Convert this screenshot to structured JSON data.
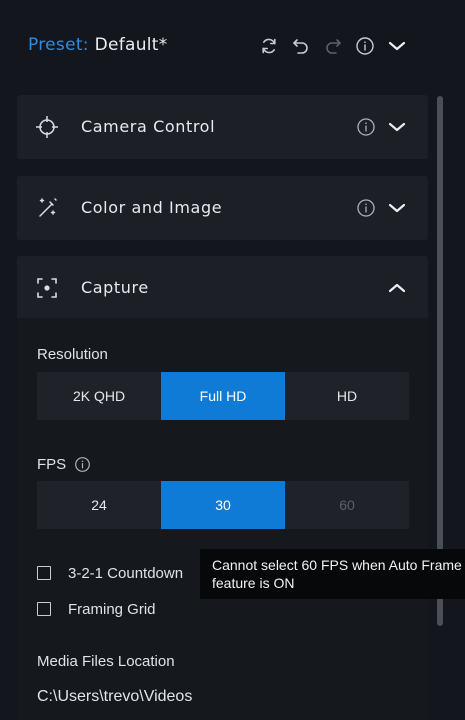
{
  "header": {
    "preset_label": "Preset:",
    "preset_value": "Default*",
    "icons": [
      "sync-icon",
      "undo-icon",
      "redo-icon",
      "info-icon",
      "chevron-down-icon"
    ]
  },
  "panels": [
    {
      "title": "Camera Control",
      "icon": "crosshair-icon",
      "expanded": false
    },
    {
      "title": "Color and Image",
      "icon": "magic-wand-icon",
      "expanded": false
    },
    {
      "title": "Capture",
      "icon": "capture-frame-icon",
      "expanded": true
    }
  ],
  "capture": {
    "resolution_label": "Resolution",
    "resolution_options": [
      "2K QHD",
      "Full HD",
      "HD"
    ],
    "resolution_selected": "Full HD",
    "fps_label": "FPS",
    "fps_options": [
      "24",
      "30",
      "60"
    ],
    "fps_selected": "30",
    "fps_disabled": "60",
    "countdown_label": "3-2-1 Countdown",
    "countdown_checked": false,
    "grid_label": "Framing Grid",
    "grid_checked": false,
    "media_label": "Media Files Location",
    "media_path": "C:\\Users\\trevo\\Videos"
  },
  "tooltip": {
    "line1": "Cannot select 60 FPS when Auto Frame",
    "line2": "feature is ON"
  },
  "colors": {
    "accent": "#0f7bd6",
    "preset_label": "#2f8ce0",
    "panel_bg": "#1c1f25",
    "background": "#13161c"
  }
}
